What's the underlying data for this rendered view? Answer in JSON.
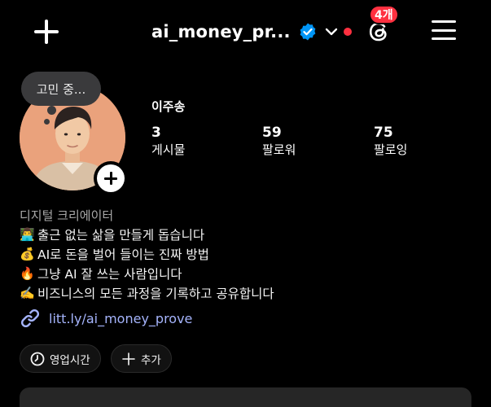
{
  "header": {
    "username": "ai_money_pr...",
    "threads_badge": "4개"
  },
  "profile": {
    "note": "고민 중...",
    "display_name": "이주송",
    "stats": [
      {
        "value": "3",
        "label": "게시물"
      },
      {
        "value": "59",
        "label": "팔로워"
      },
      {
        "value": "75",
        "label": "팔로잉"
      }
    ],
    "category": "디지털 크리에이터",
    "bio": [
      {
        "emoji": "👨‍💻",
        "text": "출근 없는 삶을 만들게 돕습니다"
      },
      {
        "emoji": "💰",
        "text": "AI로 돈을 벌어 들이는 진짜 방법"
      },
      {
        "emoji": "🔥",
        "text": "그냥 AI 잘 쓰는 사람입니다"
      },
      {
        "emoji": "✍️",
        "text": "비즈니스의 모든 과정을 기록하고 공유합니다"
      }
    ],
    "link": "litt.ly/ai_money_prove"
  },
  "chips": {
    "hours_label": "영업시간",
    "add_label": "추가"
  },
  "icons": {
    "create": "plus-icon",
    "verified": "verified-badge-icon",
    "account_switch": "chevron-down-icon",
    "threads": "threads-icon",
    "menu": "hamburger-menu-icon",
    "link": "link-icon",
    "clock": "clock-icon"
  },
  "colors": {
    "background": "#000000",
    "verified": "#0095f6",
    "notification": "#ff3040",
    "link": "#a5b4fc",
    "chip_bg": "#121212",
    "note_bg": "#3a3a3c"
  }
}
